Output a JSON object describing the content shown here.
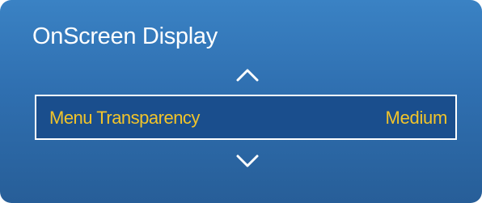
{
  "panel": {
    "title": "OnScreen Display",
    "menu_item": {
      "label": "Menu Transparency",
      "value": "Medium"
    },
    "up_icon": "chevron-up-icon",
    "down_icon": "chevron-down-icon"
  },
  "colors": {
    "panel_background": "#2f6fb0",
    "selected_row_background": "#1a4e8d",
    "highlight_text": "#f2c42a",
    "title_text": "#ffffff"
  }
}
